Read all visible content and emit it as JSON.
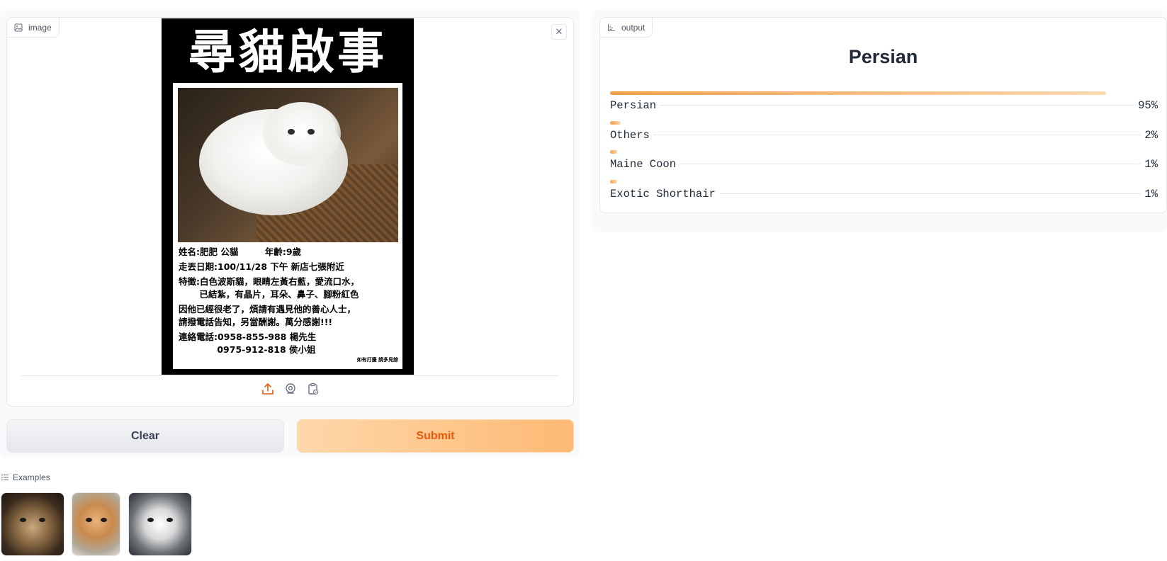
{
  "input_panel": {
    "label": "image",
    "poster": {
      "title": "尋貓啟事",
      "lines": [
        "姓名:肥肥 公貓　　　年齡:9歲",
        "走丟日期:100/11/28 下午 新店七張附近",
        "特徵:白色波斯貓，眼睛左黃右藍，愛流口水，",
        "　　 已結紮，有晶片，耳朵、鼻子、腳粉紅色",
        "因他已經很老了，煩請有遇見他的善心人士，",
        "請撥電話告知，另當酬謝。萬分感謝!!!",
        "連絡電話:0958-855-988 楊先生",
        "　　　　 0975-912-818 侯小姐"
      ],
      "note": "如有打擾 請多見諒"
    },
    "sources": [
      "upload-icon",
      "webcam-icon",
      "clipboard-icon"
    ]
  },
  "buttons": {
    "clear": "Clear",
    "submit": "Submit"
  },
  "examples": {
    "label": "Examples",
    "items": [
      "maine-coon-example",
      "persian-orange-example",
      "ragdoll-example"
    ]
  },
  "output_panel": {
    "label": "output",
    "top_label": "Persian",
    "confidences": [
      {
        "label": "Persian",
        "percent": "95%",
        "value": 0.95
      },
      {
        "label": "Others",
        "percent": "2%",
        "value": 0.02
      },
      {
        "label": "Maine Coon",
        "percent": "1%",
        "value": 0.01
      },
      {
        "label": "Exotic Shorthair",
        "percent": "1%",
        "value": 0.01
      }
    ]
  },
  "colors": {
    "accent": "#ea580c",
    "bar_start": "#f59e4b",
    "bar_end": "#fcd9b0"
  }
}
